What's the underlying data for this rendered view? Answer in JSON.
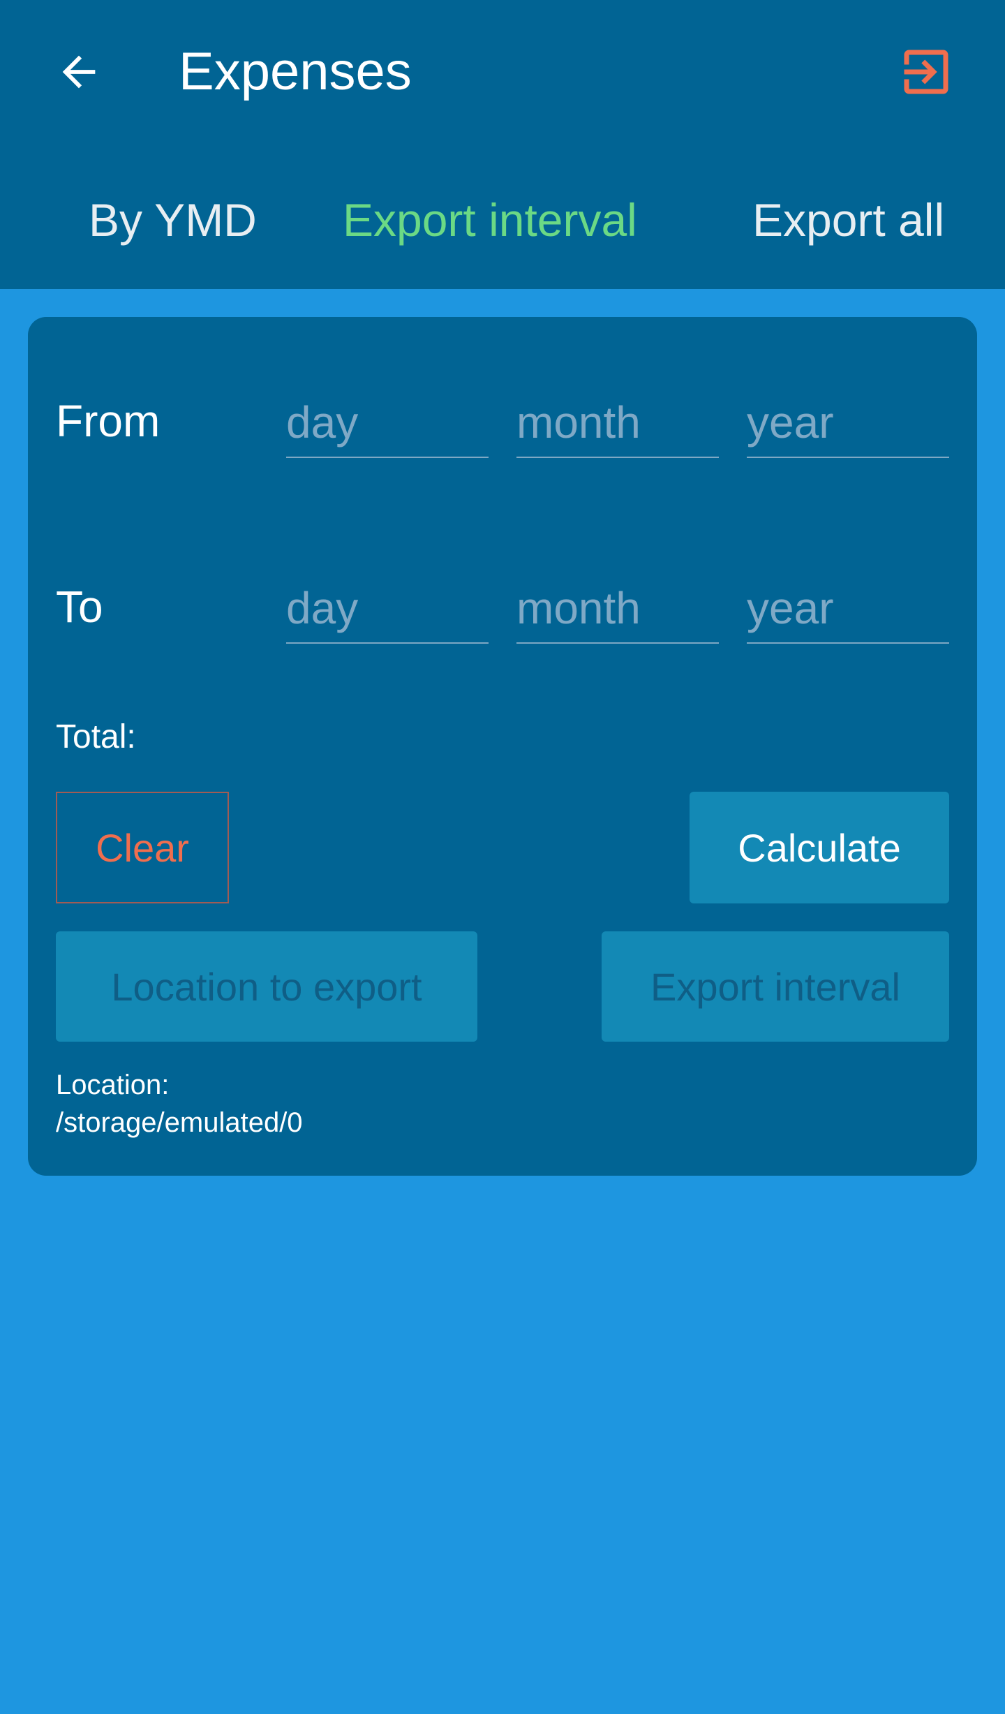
{
  "appbar": {
    "title": "Expenses",
    "back_icon": "arrow-left-icon",
    "exit_icon": "exit-to-app-icon",
    "exit_icon_color": "#F06E4E",
    "background_color": "#016494"
  },
  "tabs": [
    {
      "label": "By YMD",
      "active": false
    },
    {
      "label": "Export interval",
      "active": true
    },
    {
      "label": "Export all",
      "active": false
    }
  ],
  "colors": {
    "page_background": "#1E96E0",
    "card_background": "#016494",
    "active_tab": "#6BD985",
    "clear_text": "#F06E4E",
    "button_background": "#1389B5"
  },
  "form": {
    "from": {
      "label": "From",
      "day_placeholder": "day",
      "month_placeholder": "month",
      "year_placeholder": "year"
    },
    "to": {
      "label": "To",
      "day_placeholder": "day",
      "month_placeholder": "month",
      "year_placeholder": "year"
    },
    "total_label": "Total:"
  },
  "buttons": {
    "clear": "Clear",
    "calculate": "Calculate",
    "location_to_export": "Location to export",
    "export_interval": "Export interval"
  },
  "location": {
    "label": "Location:",
    "path": "/storage/emulated/0"
  }
}
